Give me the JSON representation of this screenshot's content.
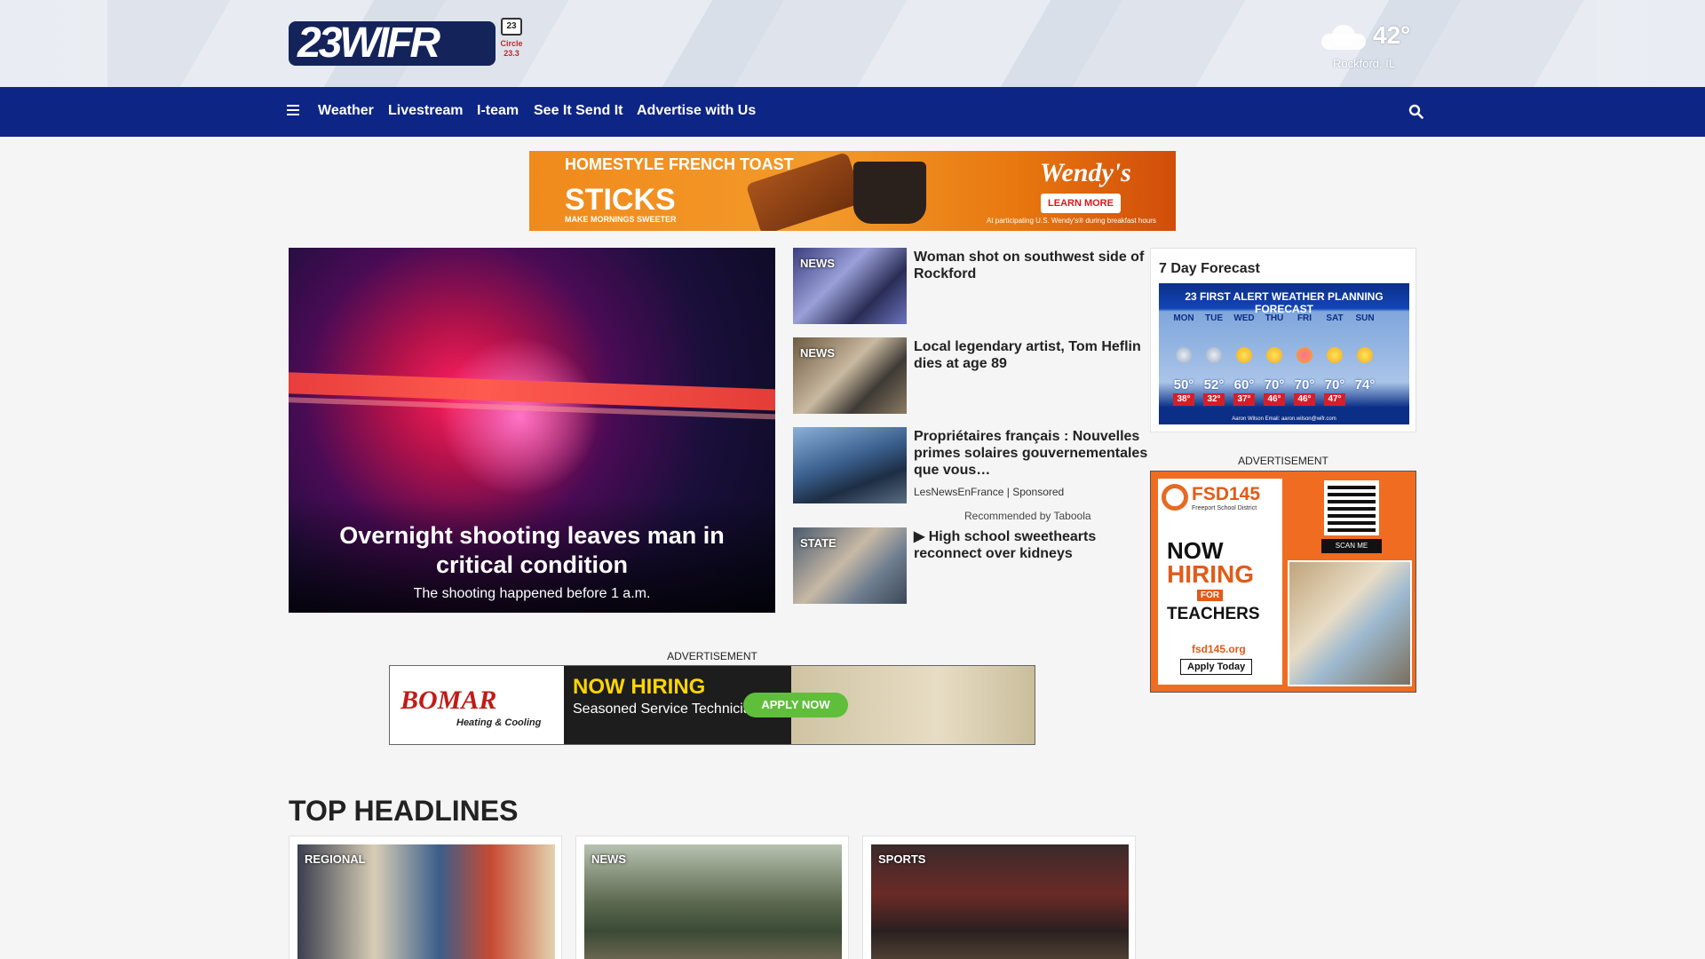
{
  "header": {
    "logo_text": "23WIFR",
    "logo_badge": "23",
    "logo_sub": "Circle 23.3",
    "weather": {
      "temp": "42°",
      "location": "Rockford, IL"
    }
  },
  "nav": {
    "items": [
      "Weather",
      "Livestream",
      "I-team",
      "See It Send It",
      "Advertise with Us"
    ]
  },
  "ad_top": {
    "line1": "HOMESTYLE FRENCH TOAST",
    "line2": "STICKS",
    "line3": "MAKE MORNINGS SWEETER",
    "brand": "Wendy's",
    "cta": "LEARN MORE",
    "fine_print": "At participating U.S. Wendy's® during breakfast hours"
  },
  "hero": {
    "title": "Overnight shooting leaves man in critical condition",
    "subtitle": "The shooting happened before 1 a.m."
  },
  "stories": [
    {
      "tag": "NEWS",
      "headline": "Woman shot on southwest side of Rockford"
    },
    {
      "tag": "NEWS",
      "headline": "Local legendary artist, Tom Heflin dies at age 89"
    },
    {
      "tag": "",
      "headline": "Propriétaires français : Nouvelles primes solaires gouvernementales que vous…",
      "source": "LesNewsEnFrance",
      "sponsored": "Sponsored"
    },
    {
      "tag": "STATE",
      "headline": "▶ High school sweethearts reconnect over kidneys"
    }
  ],
  "taboola": "Recommended by Taboola",
  "forecast": {
    "title": "7 Day Forecast",
    "banner": "23 FIRST ALERT WEATHER PLANNING FORECAST",
    "days": [
      {
        "day": "MON",
        "hi": "50°",
        "lo": "38°"
      },
      {
        "day": "TUE",
        "hi": "52°",
        "lo": "32°"
      },
      {
        "day": "WED",
        "hi": "60°",
        "lo": "37°"
      },
      {
        "day": "THU",
        "hi": "70°",
        "lo": "46°"
      },
      {
        "day": "FRI",
        "hi": "70°",
        "lo": "46°"
      },
      {
        "day": "SAT",
        "hi": "70°",
        "lo": "47°"
      },
      {
        "day": "SUN",
        "hi": "74°",
        "lo": ""
      }
    ],
    "footer": "Aaron Wilson   Email: aaron.wilson@wifr.com"
  },
  "ads": {
    "label": "ADVERTISEMENT",
    "side": {
      "brand": "FSD145",
      "brand_sub": "Freeport School District",
      "now": "NOW",
      "hiring": "HIRING",
      "for": "FOR",
      "teachers": "TEACHERS",
      "site": "fsd145.org",
      "cta": "Apply Today",
      "scan": "SCAN ME"
    },
    "bottom": {
      "brand": "BOMAR",
      "brand_sub": "Heating & Cooling",
      "headline": "NOW HIRING",
      "sub": "Seasoned Service Technicians",
      "cta": "APPLY NOW"
    }
  },
  "top_headlines": {
    "title": "TOP HEADLINES",
    "cards": [
      {
        "tag": "REGIONAL"
      },
      {
        "tag": "NEWS"
      },
      {
        "tag": "SPORTS"
      }
    ]
  }
}
